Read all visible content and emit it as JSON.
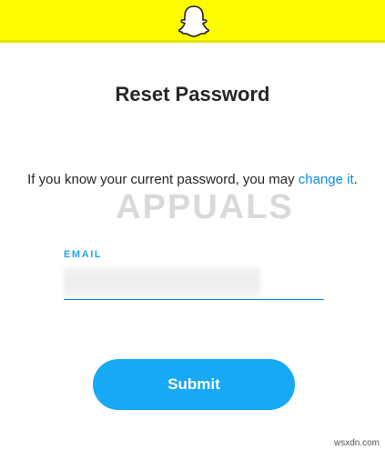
{
  "header": {
    "logo_icon": "snapchat-ghost-icon",
    "background_color": "#FFFC00"
  },
  "page": {
    "title": "Reset Password"
  },
  "hint": {
    "text": "If you know your current password, you may ",
    "link_label": "change it",
    "suffix": "."
  },
  "form": {
    "email_label": "EMAIL",
    "email_value": "",
    "submit_label": "Submit",
    "accent_color": "#17a9f3"
  },
  "overlay": {
    "watermark_text": "APPUALS",
    "site_mark": "wsxdn.com"
  }
}
